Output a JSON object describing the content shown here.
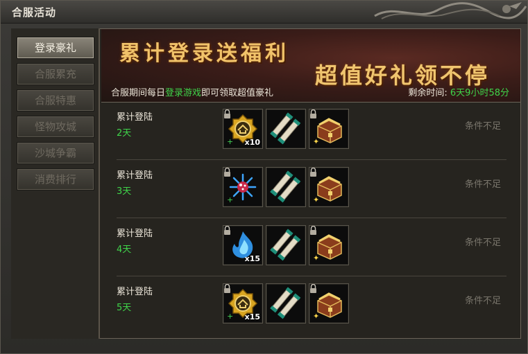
{
  "window": {
    "title": "合服活动"
  },
  "sidebar": {
    "tabs": [
      {
        "label": "登录豪礼",
        "active": true
      },
      {
        "label": "合服累充",
        "active": false
      },
      {
        "label": "合服特惠",
        "active": false
      },
      {
        "label": "怪物攻城",
        "active": false
      },
      {
        "label": "沙城争霸",
        "active": false
      },
      {
        "label": "消费排行",
        "active": false
      }
    ]
  },
  "banner": {
    "title1": "累计登录送福利",
    "title2": "超值好礼领不停",
    "desc_pre": "合服期间每日",
    "desc_highlight": "登录游戏",
    "desc_post": "即可领取超值豪礼",
    "time_label": "剩余时间:",
    "time_value": "6天9小时58分"
  },
  "rows": [
    {
      "label": "累计登陆",
      "days": "2天",
      "status": "条件不足",
      "items": [
        {
          "icon": "gold-badge-icon",
          "qty": "x10"
        },
        {
          "icon": "scroll-bundle-icon",
          "qty": ""
        },
        {
          "icon": "treasure-chest-icon",
          "qty": ""
        }
      ]
    },
    {
      "label": "累计登陆",
      "days": "3天",
      "status": "条件不足",
      "items": [
        {
          "icon": "crystal-flower-icon",
          "qty": ""
        },
        {
          "icon": "scroll-bundle-icon",
          "qty": ""
        },
        {
          "icon": "treasure-chest-icon",
          "qty": ""
        }
      ]
    },
    {
      "label": "累计登陆",
      "days": "4天",
      "status": "条件不足",
      "items": [
        {
          "icon": "blue-flame-icon",
          "qty": "x15"
        },
        {
          "icon": "scroll-bundle-icon",
          "qty": ""
        },
        {
          "icon": "treasure-chest-icon",
          "qty": ""
        }
      ]
    },
    {
      "label": "累计登陆",
      "days": "5天",
      "status": "条件不足",
      "items": [
        {
          "icon": "gold-badge-icon",
          "qty": "x15"
        },
        {
          "icon": "scroll-bundle-icon",
          "qty": ""
        },
        {
          "icon": "treasure-chest-icon",
          "qty": ""
        }
      ]
    }
  ],
  "colors": {
    "highlight_green": "#3fd44a",
    "banner_gold": "#f1c36a",
    "status_gray": "#7a766c"
  }
}
